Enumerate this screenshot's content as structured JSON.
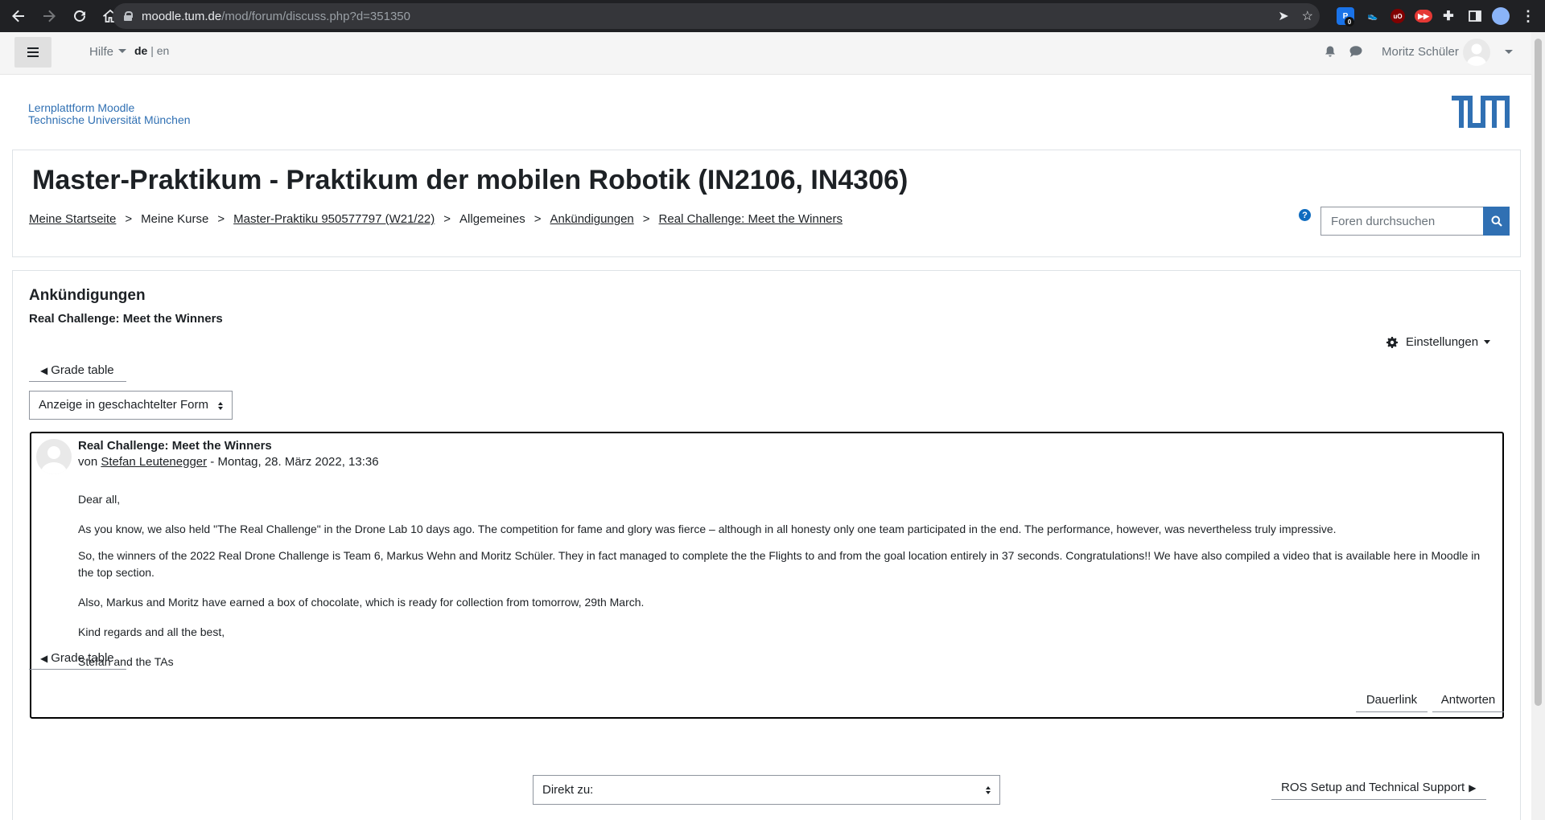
{
  "browser": {
    "url_host": "moodle.tum.de",
    "url_path": "/mod/forum/discuss.php?d=351350",
    "nav_icons": [
      "back-icon",
      "forward-icon",
      "reload-icon",
      "home-icon"
    ],
    "extension_badge": "0"
  },
  "navbar": {
    "help_label": "Hilfe",
    "lang_current": "de",
    "lang_separator": "|",
    "lang_other": "en",
    "user_name": "Moritz Schüler"
  },
  "site": {
    "line1": "Lernplattform Moodle",
    "line2": "Technische Universität München"
  },
  "header": {
    "course_title": "Master-Praktikum - Praktikum der mobilen Robotik (IN2106, IN4306)",
    "breadcrumb": [
      {
        "label": "Meine Startseite",
        "link": true
      },
      {
        "label": "Meine Kurse",
        "link": false
      },
      {
        "label": "Master-Praktiku 950577797 (W21/22)",
        "link": true
      },
      {
        "label": "Allgemeines",
        "link": false
      },
      {
        "label": "Ankündigungen",
        "link": true
      },
      {
        "label": "Real Challenge: Meet the Winners",
        "link": true
      }
    ],
    "breadcrumb_separator": ">",
    "search_placeholder": "Foren durchsuchen"
  },
  "main": {
    "forum_name": "Ankündigungen",
    "discussion_name": "Real Challenge: Meet the Winners",
    "settings_label": "Einstellungen",
    "grade_table_label": "Grade table",
    "display_mode": "Anzeige in geschachtelter Form",
    "post": {
      "subject": "Real Challenge: Meet the Winners",
      "by_prefix": "von",
      "author": "Stefan Leutenegger",
      "date": " - Montag, 28. März 2022, 13:36",
      "body": [
        "Dear all,",
        "As you know, we also held \"The Real Challenge\" in the Drone Lab 10 days ago. The competition for fame and glory was fierce – although in all honesty only one team participated in the end. The performance, however, was nevertheless truly impressive.",
        "So, the winners of the 2022 Real Drone Challenge is Team 6, Markus Wehn and Moritz Schüler. They in fact managed to complete the the Flights to and from the goal location entirely in 37 seconds. Congratulations!! We have also compiled a video that is available here in Moodle in the top section.",
        "Also, Markus and Moritz have earned a box of chocolate, which is ready for collection from tomorrow, 29th March.",
        "Kind regards and all the best,",
        "Stefan and the TAs"
      ],
      "permalink_label": "Dauerlink",
      "reply_label": "Antworten"
    },
    "jump_to_label": "Direkt zu:",
    "next_activity_label": "ROS Setup and Technical Support"
  },
  "colors": {
    "chrome_bg": "#202124",
    "link_blue": "#3070b3",
    "search_button": "#3070b3",
    "help_icon": "#0f6cbf"
  }
}
